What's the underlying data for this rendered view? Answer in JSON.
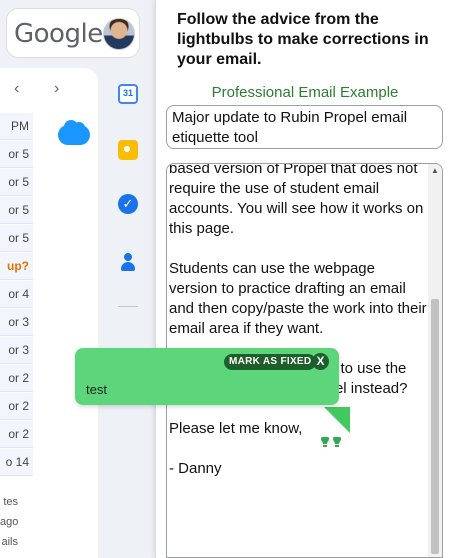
{
  "gmail": {
    "logo_text": "Google",
    "mail_times": [
      "PM",
      "or 5",
      "or 5",
      "or 5",
      "or 5",
      "up?",
      "or 4",
      "or 3",
      "or 3",
      "or 2",
      "or 2",
      "or 2",
      "o 14"
    ],
    "footer": [
      "tes",
      "ago",
      "ails"
    ],
    "calendar_day": "31"
  },
  "panel": {
    "instructions": "Follow the advice from the lightbulbs to make corrections in your email.",
    "example_label": "Professional Email Example",
    "subject": "Major update to Rubin Propel email etiquette tool",
    "body": "based version of Propel that does not require the use of student email accounts. You will see how it works on this page.\n\nStudents can use the webpage version to practice drafting an email and then copy/paste the work into their email area if they want.\n\nWould you rather be able to use the webpage version of Propel instead?\n\nPlease let me know,\n\n- Danny",
    "bulbs": "♥♥"
  },
  "popup": {
    "mark_fixed_label": "MARK AS FIXED",
    "close_label": "X",
    "message": "test"
  },
  "colors": {
    "popup_bg": "#5dd57a",
    "badge_bg": "#1e5e2a",
    "example_label": "#2e7d32"
  }
}
